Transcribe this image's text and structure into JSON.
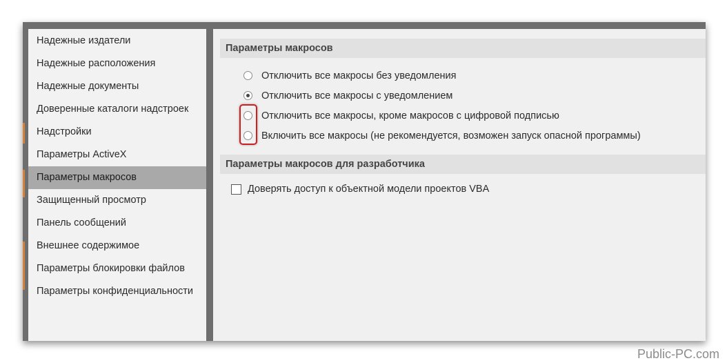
{
  "sidebar": {
    "items": [
      {
        "label": "Надежные издатели"
      },
      {
        "label": "Надежные расположения"
      },
      {
        "label": "Надежные документы"
      },
      {
        "label": "Доверенные каталоги надстроек"
      },
      {
        "label": "Надстройки"
      },
      {
        "label": "Параметры ActiveX"
      },
      {
        "label": "Параметры макросов",
        "selected": true
      },
      {
        "label": "Защищенный просмотр"
      },
      {
        "label": "Панель сообщений"
      },
      {
        "label": "Внешнее содержимое"
      },
      {
        "label": "Параметры блокировки файлов"
      },
      {
        "label": "Параметры конфиденциальности"
      }
    ]
  },
  "macro_settings": {
    "header": "Параметры макросов",
    "options": [
      {
        "label": "Отключить все макросы без уведомления",
        "checked": false
      },
      {
        "label": "Отключить все макросы с уведомлением",
        "checked": true
      },
      {
        "label": "Отключить все макросы, кроме макросов с цифровой подписью",
        "checked": false
      },
      {
        "label": "Включить все макросы (не рекомендуется, возможен запуск опасной программы)",
        "checked": false
      }
    ]
  },
  "developer_settings": {
    "header": "Параметры макросов для разработчика",
    "vba_access_label": "Доверять доступ к объектной модели проектов VBA",
    "vba_access_checked": false
  },
  "watermark": "Public-PC.com",
  "colors": {
    "highlight": "#cc1f1f",
    "selected_item": "#a9a9a9",
    "accent_orange": "#d4833e"
  }
}
